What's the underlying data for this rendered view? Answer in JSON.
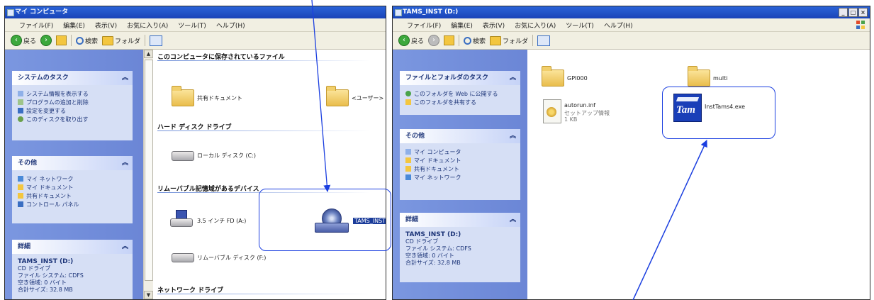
{
  "colors": {
    "accent": "#1b3fe0",
    "titlebar": "#2a63d8",
    "task_pane": "#7b97e0"
  },
  "left_window": {
    "title": "マイ コンピュータ",
    "menu": [
      "ファイル(F)",
      "編集(E)",
      "表示(V)",
      "お気に入り(A)",
      "ツール(T)",
      "ヘルプ(H)"
    ],
    "toolbar": {
      "back": "戻る",
      "search": "検索",
      "folders": "フォルダ"
    },
    "tasks_panel": {
      "title": "システムのタスク",
      "items": [
        "システム情報を表示する",
        "プログラムの追加と削除",
        "設定を変更する",
        "このディスクを取り出す"
      ]
    },
    "other_panel": {
      "title": "その他",
      "items": [
        "マイ ネットワーク",
        "マイ ドキュメント",
        "共有ドキュメント",
        "コントロール パネル"
      ]
    },
    "details_panel": {
      "title": "詳細",
      "name": "TAMS_INST (D:)",
      "lines": [
        "CD ドライブ",
        "ファイル システム: CDFS",
        "空き領域: 0 バイト",
        "合計サイズ: 32.8 MB"
      ]
    },
    "sections": {
      "stored": "このコンピュータに保存されているファイル",
      "hdd": "ハード ディスク ドライブ",
      "removable": "リムーバブル記憶域があるデバイス",
      "network": "ネットワーク ドライブ"
    },
    "items": {
      "shared_docs": "共有ドキュメント",
      "user_docs": "<ユーザー> のドキュメント",
      "local_disk": "ローカル ディスク (C:)",
      "floppy": "3.5 インチ FD (A:)",
      "cd_drive": "TAMS_INST (D:)",
      "removable_disk": "リムーバブル ディスク (F:)"
    }
  },
  "right_window": {
    "title": "TAMS_INST (D:)",
    "menu": [
      "ファイル(F)",
      "編集(E)",
      "表示(V)",
      "お気に入り(A)",
      "ツール(T)",
      "ヘルプ(H)"
    ],
    "toolbar": {
      "back": "戻る",
      "search": "検索",
      "folders": "フォルダ"
    },
    "tasks_panel": {
      "title": "ファイルとフォルダのタスク",
      "items": [
        "このフォルダを Web に公開する",
        "このフォルダを共有する"
      ]
    },
    "other_panel": {
      "title": "その他",
      "items": [
        "マイ コンピュータ",
        "マイ ドキュメント",
        "共有ドキュメント",
        "マイ ネットワーク"
      ]
    },
    "details_panel": {
      "title": "詳細",
      "name": "TAMS_INST (D:)",
      "lines": [
        "CD ドライブ",
        "ファイル システム: CDFS",
        "空き領域: 0 バイト",
        "合計サイズ: 32.8 MB"
      ]
    },
    "items": {
      "folder1": "GPI000",
      "folder2": "multi",
      "autorun_name": "autorun.inf",
      "autorun_type": "セットアップ情報",
      "autorun_size": "1 KB",
      "installer": "InstTams4.exe",
      "installer_logo": "Tam"
    }
  }
}
